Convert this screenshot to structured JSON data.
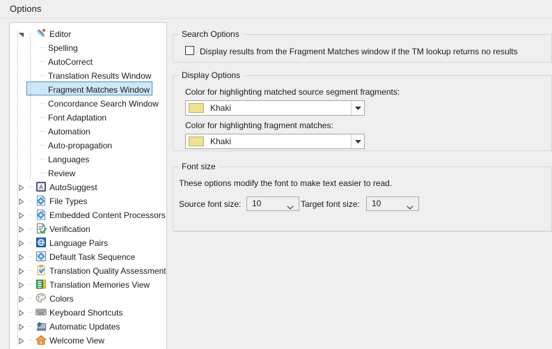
{
  "window": {
    "title": "Options"
  },
  "tree": {
    "items": [
      {
        "label": "Editor",
        "level": 0,
        "icon": "pencil-icon",
        "expander": "expanded"
      },
      {
        "label": "Spelling",
        "level": 1,
        "icon": "none",
        "expander": "none"
      },
      {
        "label": "AutoCorrect",
        "level": 1,
        "icon": "none",
        "expander": "none"
      },
      {
        "label": "Translation Results Window",
        "level": 1,
        "icon": "none",
        "expander": "none"
      },
      {
        "label": "Fragment Matches Window",
        "level": 1,
        "icon": "none",
        "expander": "none",
        "selected": true
      },
      {
        "label": "Concordance Search Window",
        "level": 1,
        "icon": "none",
        "expander": "none"
      },
      {
        "label": "Font Adaptation",
        "level": 1,
        "icon": "none",
        "expander": "none"
      },
      {
        "label": "Automation",
        "level": 1,
        "icon": "none",
        "expander": "none"
      },
      {
        "label": "Auto-propagation",
        "level": 1,
        "icon": "none",
        "expander": "none"
      },
      {
        "label": "Languages",
        "level": 1,
        "icon": "none",
        "expander": "none"
      },
      {
        "label": "Review",
        "level": 1,
        "icon": "none",
        "expander": "none"
      },
      {
        "label": "AutoSuggest",
        "level": 0,
        "icon": "autosuggest-icon",
        "expander": "collapsed"
      },
      {
        "label": "File Types",
        "level": 0,
        "icon": "file-gear-icon",
        "expander": "collapsed"
      },
      {
        "label": "Embedded Content Processors",
        "level": 0,
        "icon": "file-gear-icon",
        "expander": "collapsed"
      },
      {
        "label": "Verification",
        "level": 0,
        "icon": "verification-check-icon",
        "expander": "collapsed"
      },
      {
        "label": "Language Pairs",
        "level": 0,
        "icon": "globe-icon",
        "expander": "collapsed"
      },
      {
        "label": "Default Task Sequence",
        "level": 0,
        "icon": "gear-square-icon",
        "expander": "collapsed"
      },
      {
        "label": "Translation Quality Assessment",
        "level": 0,
        "icon": "clipboard-check-icon",
        "expander": "collapsed"
      },
      {
        "label": "Translation Memories View",
        "level": 0,
        "icon": "memory-bars-icon",
        "expander": "collapsed"
      },
      {
        "label": "Colors",
        "level": 0,
        "icon": "palette-icon",
        "expander": "collapsed"
      },
      {
        "label": "Keyboard Shortcuts",
        "level": 0,
        "icon": "keyboard-icon",
        "expander": "collapsed"
      },
      {
        "label": "Automatic Updates",
        "level": 0,
        "icon": "monitor-update-icon",
        "expander": "collapsed"
      },
      {
        "label": "Welcome View",
        "level": 0,
        "icon": "home-icon",
        "expander": "collapsed"
      }
    ]
  },
  "content": {
    "search_options": {
      "title": "Search Options",
      "checkbox_label": "Display results from the Fragment Matches window if the TM lookup returns no results",
      "checkbox_checked": false
    },
    "display_options": {
      "title": "Display Options",
      "source_fragment_label": "Color for highlighting matched source segment fragments:",
      "source_fragment_value": "Khaki",
      "source_fragment_color": "#ece28f",
      "fragment_matches_label": "Color for highlighting fragment matches:",
      "fragment_matches_value": "Khaki",
      "fragment_matches_color": "#ece28f"
    },
    "font_size": {
      "title": "Font size",
      "description": "These options modify the font to make text easier to read.",
      "source_label": "Source font size:",
      "source_value": "10",
      "target_label": "Target font size:",
      "target_value": "10"
    }
  },
  "theme": {
    "background": "#efefef",
    "panel_background": "#ffffff",
    "selection_fill": "#cde8f7",
    "selection_border": "#4a90c4",
    "text": "#1b1b1b",
    "group_border": "#d7d7d7"
  }
}
